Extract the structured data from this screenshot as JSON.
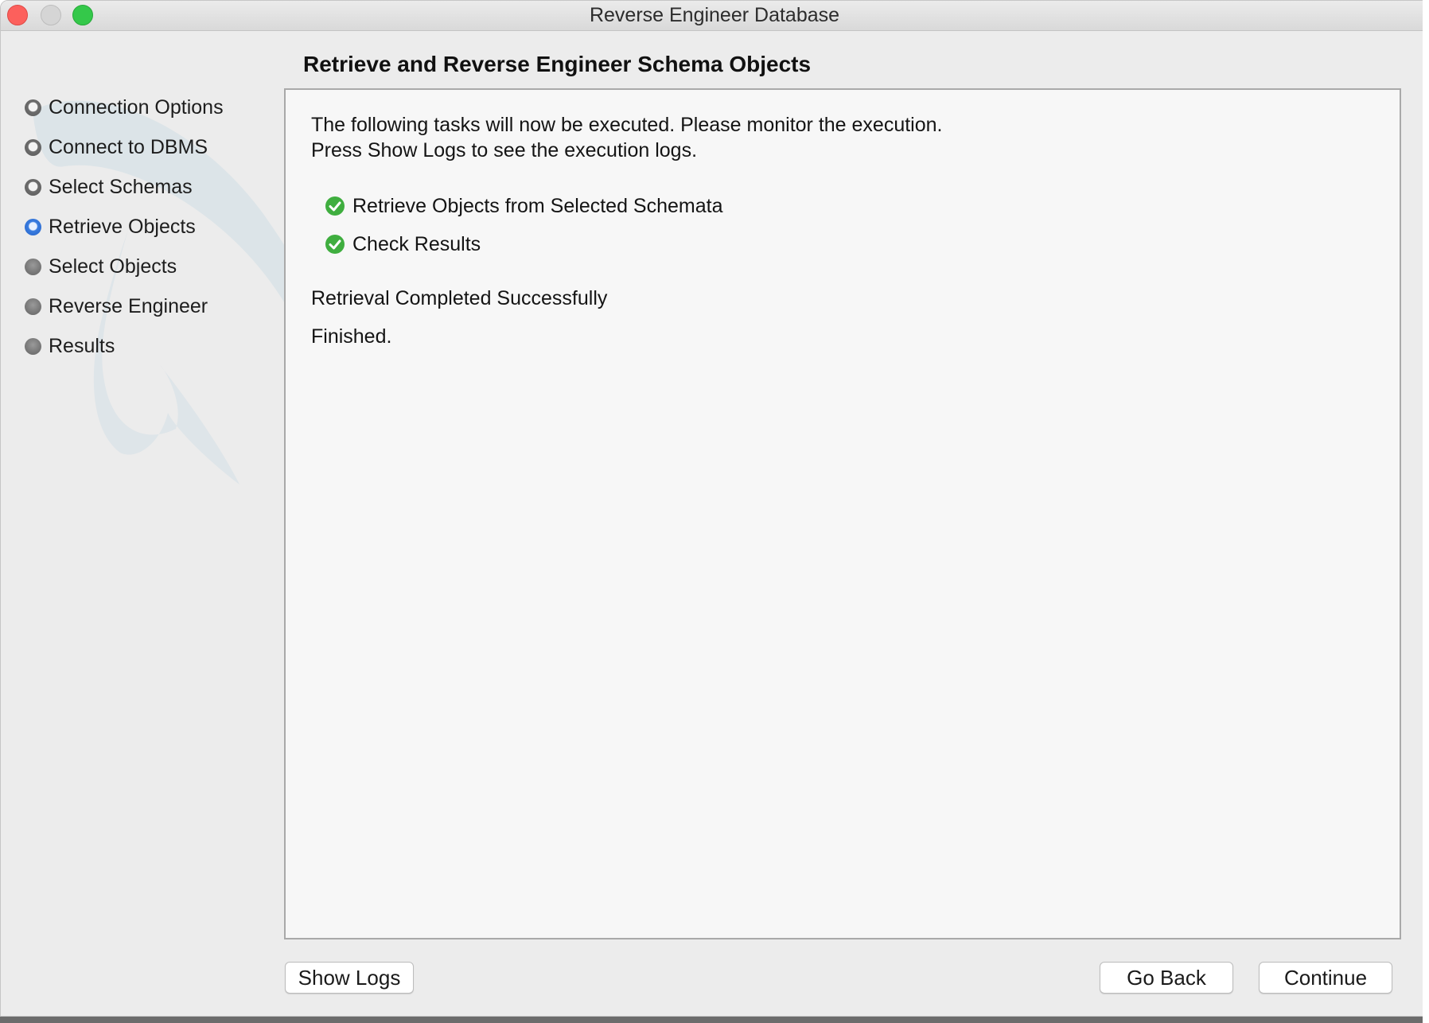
{
  "window": {
    "title": "Reverse Engineer Database"
  },
  "sidebar": {
    "steps": [
      {
        "label": "Connection Options",
        "state": "done"
      },
      {
        "label": "Connect to DBMS",
        "state": "done"
      },
      {
        "label": "Select Schemas",
        "state": "done"
      },
      {
        "label": "Retrieve Objects",
        "state": "active"
      },
      {
        "label": "Select Objects",
        "state": "todo"
      },
      {
        "label": "Reverse Engineer",
        "state": "todo"
      },
      {
        "label": "Results",
        "state": "todo"
      }
    ]
  },
  "main": {
    "title": "Retrieve and Reverse Engineer Schema Objects",
    "intro_line1": "The following tasks will now be executed. Please monitor the execution.",
    "intro_line2": "Press Show Logs to see the execution logs.",
    "tasks": [
      {
        "label": "Retrieve Objects from Selected Schemata",
        "status": "success",
        "icon": "check-circle-icon"
      },
      {
        "label": "Check Results",
        "status": "success",
        "icon": "check-circle-icon"
      }
    ],
    "status_message": "Retrieval Completed Successfully",
    "finished_message": "Finished."
  },
  "buttons": {
    "show_logs": "Show Logs",
    "go_back": "Go Back",
    "continue": "Continue"
  },
  "colors": {
    "active_step": "#2f73d8",
    "success": "#3fae3f",
    "close": "#fc605c",
    "zoom": "#34c84a"
  }
}
